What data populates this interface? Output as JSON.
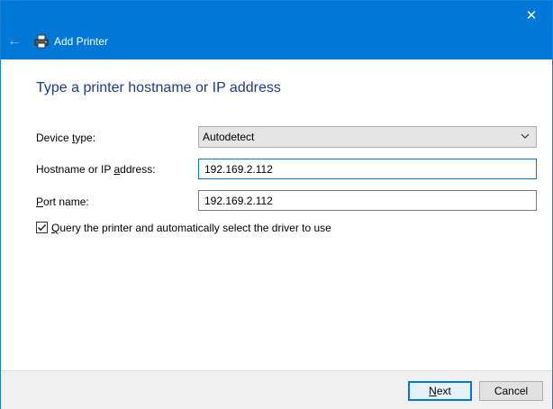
{
  "window": {
    "title": "Add Printer",
    "close_glyph": "✕",
    "back_glyph": "←",
    "titlebar_color": "#0078d7"
  },
  "page": {
    "heading": "Type a printer hostname or IP address"
  },
  "form": {
    "device_type": {
      "label_pre": "Device ",
      "label_access": "t",
      "label_post": "ype:",
      "value": "Autodetect"
    },
    "hostname": {
      "label_pre": "Hostname or IP ",
      "label_access": "a",
      "label_post": "ddress:",
      "value": "192.169.2.112"
    },
    "port": {
      "label_pre": "",
      "label_access": "P",
      "label_post": "ort name:",
      "value": "192.169.2.112"
    },
    "query": {
      "checked": true,
      "label_access": "Q",
      "label_post": "uery the printer and automatically select the driver to use"
    }
  },
  "buttons": {
    "next_access": "N",
    "next_post": "ext",
    "cancel": "Cancel"
  },
  "icons": {
    "printer": "printer-icon",
    "back": "back-arrow-icon",
    "close": "close-icon",
    "dropdown": "chevron-down-icon",
    "check": "checkmark-icon"
  }
}
